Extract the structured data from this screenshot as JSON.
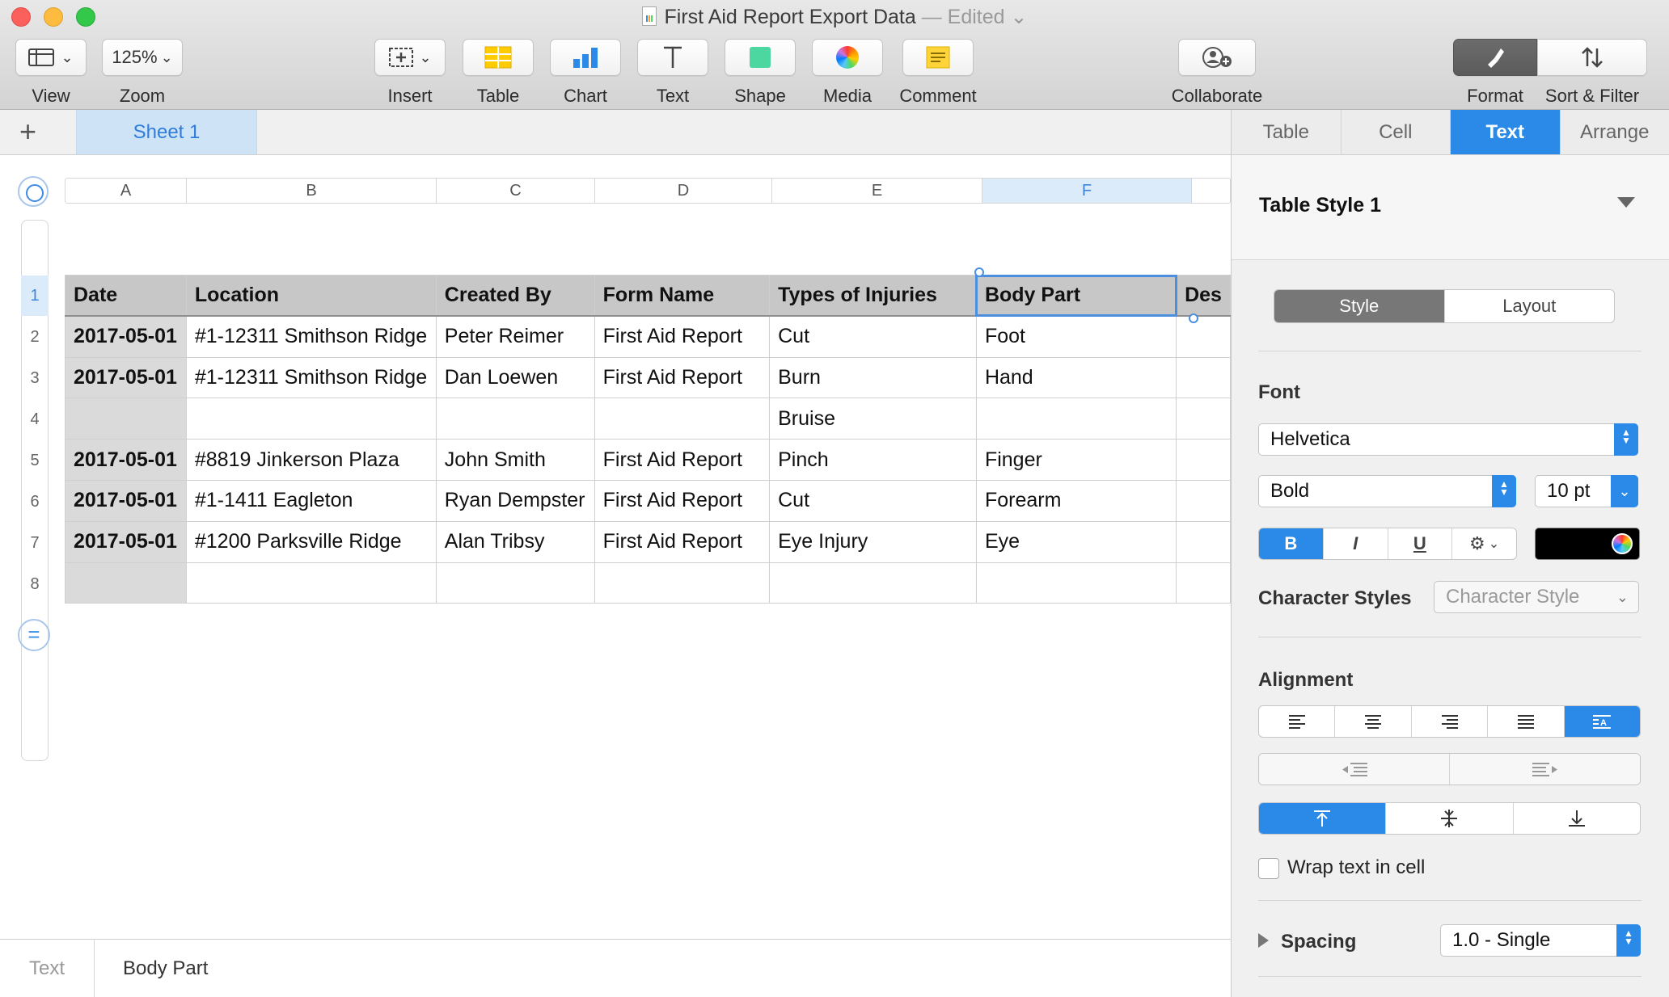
{
  "window": {
    "title": "First Aid Report Export Data",
    "status": "— Edited"
  },
  "toolbar": {
    "view_label": "View",
    "zoom_value": "125%",
    "zoom_label": "Zoom",
    "insert_label": "Insert",
    "table_label": "Table",
    "chart_label": "Chart",
    "text_label": "Text",
    "shape_label": "Shape",
    "media_label": "Media",
    "comment_label": "Comment",
    "collaborate_label": "Collaborate",
    "format_label": "Format",
    "sort_filter_label": "Sort & Filter"
  },
  "sheets": {
    "add_label": "+",
    "tabs": [
      "Sheet 1"
    ]
  },
  "grid": {
    "columns": [
      "A",
      "B",
      "C",
      "D",
      "E",
      "F"
    ],
    "rows": [
      "1",
      "2",
      "3",
      "4",
      "5",
      "6",
      "7",
      "8"
    ],
    "selected_column": "F",
    "selected_row": "1"
  },
  "table": {
    "headers": [
      "Date",
      "Location",
      "Created By",
      "Form Name",
      "Types of Injuries",
      "Body Part",
      "Des"
    ],
    "rows": [
      [
        "2017-05-01",
        "#1-12311 Smithson Ridge",
        "Peter Reimer",
        "First Aid Report",
        "Cut",
        "Foot",
        ""
      ],
      [
        "2017-05-01",
        "#1-12311 Smithson Ridge",
        "Dan Loewen",
        "First Aid Report",
        "Burn",
        "Hand",
        ""
      ],
      [
        "",
        "",
        "",
        "",
        "Bruise",
        "",
        ""
      ],
      [
        "2017-05-01",
        "#8819 Jinkerson Plaza",
        "John Smith",
        "First Aid Report",
        "Pinch",
        "Finger",
        ""
      ],
      [
        "2017-05-01",
        "#1-1411 Eagleton",
        "Ryan Dempster",
        "First Aid Report",
        "Cut",
        "Forearm",
        ""
      ],
      [
        "2017-05-01",
        "#1200 Parksville Ridge",
        "Alan Tribsy",
        "First Aid Report",
        "Eye Injury",
        "Eye",
        ""
      ],
      [
        "",
        "",
        "",
        "",
        "",
        "",
        ""
      ]
    ]
  },
  "statusbar": {
    "left": "Text",
    "right": "Body Part"
  },
  "inspector": {
    "tabs": [
      "Table",
      "Cell",
      "Text",
      "Arrange"
    ],
    "active_tab": "Text",
    "table_style": "Table Style 1",
    "style_tabs": [
      "Style",
      "Layout"
    ],
    "font_label": "Font",
    "font_family": "Helvetica",
    "font_typeface": "Bold",
    "font_size": "10 pt",
    "bold": "B",
    "italic": "I",
    "underline": "U",
    "text_color": "#000000",
    "char_styles_label": "Character Styles",
    "char_style_placeholder": "Character Style",
    "alignment_label": "Alignment",
    "wrap_label": "Wrap text in cell",
    "spacing_label": "Spacing",
    "spacing_value": "1.0 - Single"
  },
  "colors": {
    "accent": "#2b8ae8",
    "selection": "#4a8fe0",
    "header_fill": "#c7c7c7"
  }
}
